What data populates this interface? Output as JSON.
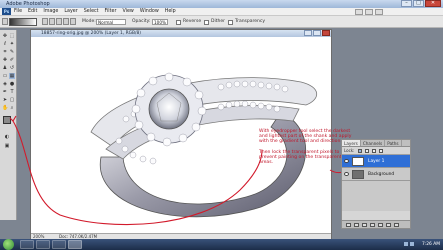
{
  "window": {
    "title": "Adobe Photoshop"
  },
  "window_controls": {
    "minimize": "–",
    "maximize": "□",
    "close": "✕"
  },
  "menubar": {
    "app_badge": "Ps",
    "items": [
      "File",
      "Edit",
      "Image",
      "Layer",
      "Select",
      "Filter",
      "View",
      "Window",
      "Help"
    ]
  },
  "options_bar": {
    "mode_label": "Mode:",
    "mode_value": "Normal",
    "opacity_label": "Opacity:",
    "opacity_value": "100%",
    "reverse_label": "Reverse",
    "dither_label": "Dither",
    "transparency_label": "Transparency"
  },
  "document": {
    "title": "18857-ring-orig.jpg @ 200% (Layer 1, RGB/8)",
    "zoom": "200%",
    "doc_size": "Doc: 747.0K/2.47M"
  },
  "annotation": {
    "color": "#c0162a",
    "paragraph_1": "With eyedropper tool select the darkest and lightest part of the shank and apply with the gradient tool and direction.",
    "paragraph_2": "Then lock the transparent pixels to prevent painting on the transparent areas."
  },
  "layers_panel": {
    "tabs": [
      "Layers",
      "Channels",
      "Paths"
    ],
    "lock_label": "Lock:",
    "layers": [
      {
        "name": "Layer 1",
        "selected": true
      },
      {
        "name": "Background",
        "selected": false
      }
    ]
  },
  "taskbar": {
    "clock": "7:26 AM"
  }
}
